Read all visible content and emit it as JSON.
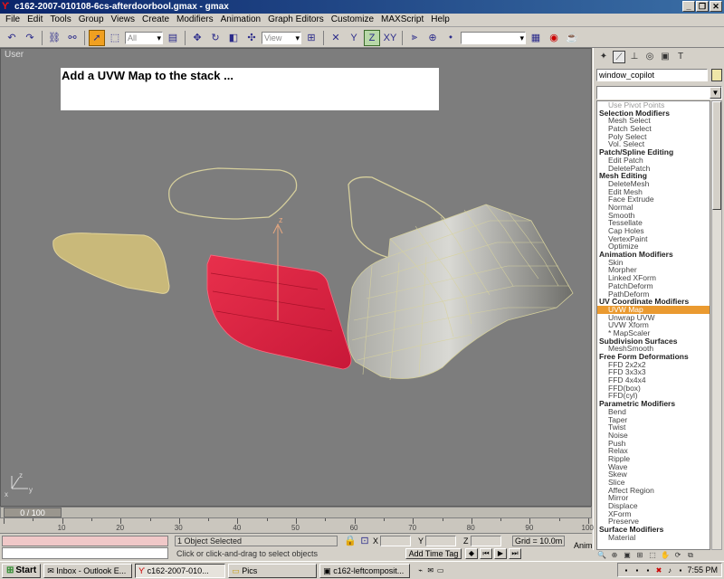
{
  "window": {
    "title": "c162-2007-010108-6cs-afterdoorbool.gmax - gmax",
    "minimize": "_",
    "restore": "❐",
    "close": "✕"
  },
  "menu": [
    "File",
    "Edit",
    "Tools",
    "Group",
    "Views",
    "Create",
    "Modifiers",
    "Animation",
    "Graph Editors",
    "Customize",
    "MAXScript",
    "Help"
  ],
  "toolbar": {
    "selection_filter": "All",
    "ref_coord": "View",
    "axis_z": "Z",
    "axis_xy": "XY"
  },
  "viewport": {
    "label": "User",
    "hint": "Add a UVW Map to the stack ..."
  },
  "command_panel": {
    "object_name": "window_copilot",
    "list": [
      {
        "t": "item",
        "label": "Use Pivot Points",
        "dim": true
      },
      {
        "t": "head",
        "label": "Selection Modifiers"
      },
      {
        "t": "item",
        "label": "Mesh Select"
      },
      {
        "t": "item",
        "label": "Patch Select"
      },
      {
        "t": "item",
        "label": "Poly Select"
      },
      {
        "t": "item",
        "label": "Vol. Select"
      },
      {
        "t": "head",
        "label": "Patch/Spline Editing"
      },
      {
        "t": "item",
        "label": "Edit Patch"
      },
      {
        "t": "item",
        "label": "DeletePatch"
      },
      {
        "t": "head",
        "label": "Mesh Editing"
      },
      {
        "t": "item",
        "label": "DeleteMesh"
      },
      {
        "t": "item",
        "label": "Edit Mesh"
      },
      {
        "t": "item",
        "label": "Face Extrude"
      },
      {
        "t": "item",
        "label": "Normal"
      },
      {
        "t": "item",
        "label": "Smooth"
      },
      {
        "t": "item",
        "label": "Tessellate"
      },
      {
        "t": "item",
        "label": "Cap Holes"
      },
      {
        "t": "item",
        "label": "VertexPaint"
      },
      {
        "t": "item",
        "label": "Optimize"
      },
      {
        "t": "head",
        "label": "Animation Modifiers"
      },
      {
        "t": "item",
        "label": "Skin"
      },
      {
        "t": "item",
        "label": "Morpher"
      },
      {
        "t": "item",
        "label": "Linked XForm"
      },
      {
        "t": "item",
        "label": "PatchDeform"
      },
      {
        "t": "item",
        "label": "PathDeform"
      },
      {
        "t": "head",
        "label": "UV Coordinate Modifiers"
      },
      {
        "t": "item",
        "label": "UVW Map",
        "selected": true
      },
      {
        "t": "item",
        "label": "Unwrap UVW"
      },
      {
        "t": "item",
        "label": "UVW Xform"
      },
      {
        "t": "item",
        "label": "* MapScaler"
      },
      {
        "t": "head",
        "label": "Subdivision Surfaces"
      },
      {
        "t": "item",
        "label": "MeshSmooth"
      },
      {
        "t": "head",
        "label": "Free Form Deformations"
      },
      {
        "t": "item",
        "label": "FFD 2x2x2"
      },
      {
        "t": "item",
        "label": "FFD 3x3x3"
      },
      {
        "t": "item",
        "label": "FFD 4x4x4"
      },
      {
        "t": "item",
        "label": "FFD(box)"
      },
      {
        "t": "item",
        "label": "FFD(cyl)"
      },
      {
        "t": "head",
        "label": "Parametric Modifiers"
      },
      {
        "t": "item",
        "label": "Bend"
      },
      {
        "t": "item",
        "label": "Taper"
      },
      {
        "t": "item",
        "label": "Twist"
      },
      {
        "t": "item",
        "label": "Noise"
      },
      {
        "t": "item",
        "label": "Push"
      },
      {
        "t": "item",
        "label": "Relax"
      },
      {
        "t": "item",
        "label": "Ripple"
      },
      {
        "t": "item",
        "label": "Wave"
      },
      {
        "t": "item",
        "label": "Skew"
      },
      {
        "t": "item",
        "label": "Slice"
      },
      {
        "t": "item",
        "label": "Affect Region"
      },
      {
        "t": "item",
        "label": "Mirror"
      },
      {
        "t": "item",
        "label": "Displace"
      },
      {
        "t": "item",
        "label": "XForm"
      },
      {
        "t": "item",
        "label": "Preserve"
      },
      {
        "t": "head",
        "label": "Surface Modifiers"
      },
      {
        "t": "item",
        "label": "Material"
      }
    ]
  },
  "timeline": {
    "slider_label": "0 / 100",
    "ticks": [
      "10",
      "20",
      "30",
      "40",
      "50",
      "60",
      "70",
      "80",
      "90",
      "100"
    ]
  },
  "status": {
    "selection": "1 Object Selected",
    "prompt": "Click or click-and-drag to select objects",
    "x_label": "X",
    "y_label": "Y",
    "z_label": "Z",
    "grid": "Grid = 10.0m",
    "add_time_tag": "Add Time Tag",
    "anim": "Anim"
  },
  "taskbar": {
    "start": "Start",
    "buttons": [
      "Inbox - Outlook E...",
      "c162-2007-010...",
      "Pics",
      "c162-leftcomposit..."
    ],
    "clock": "7:55 PM"
  }
}
